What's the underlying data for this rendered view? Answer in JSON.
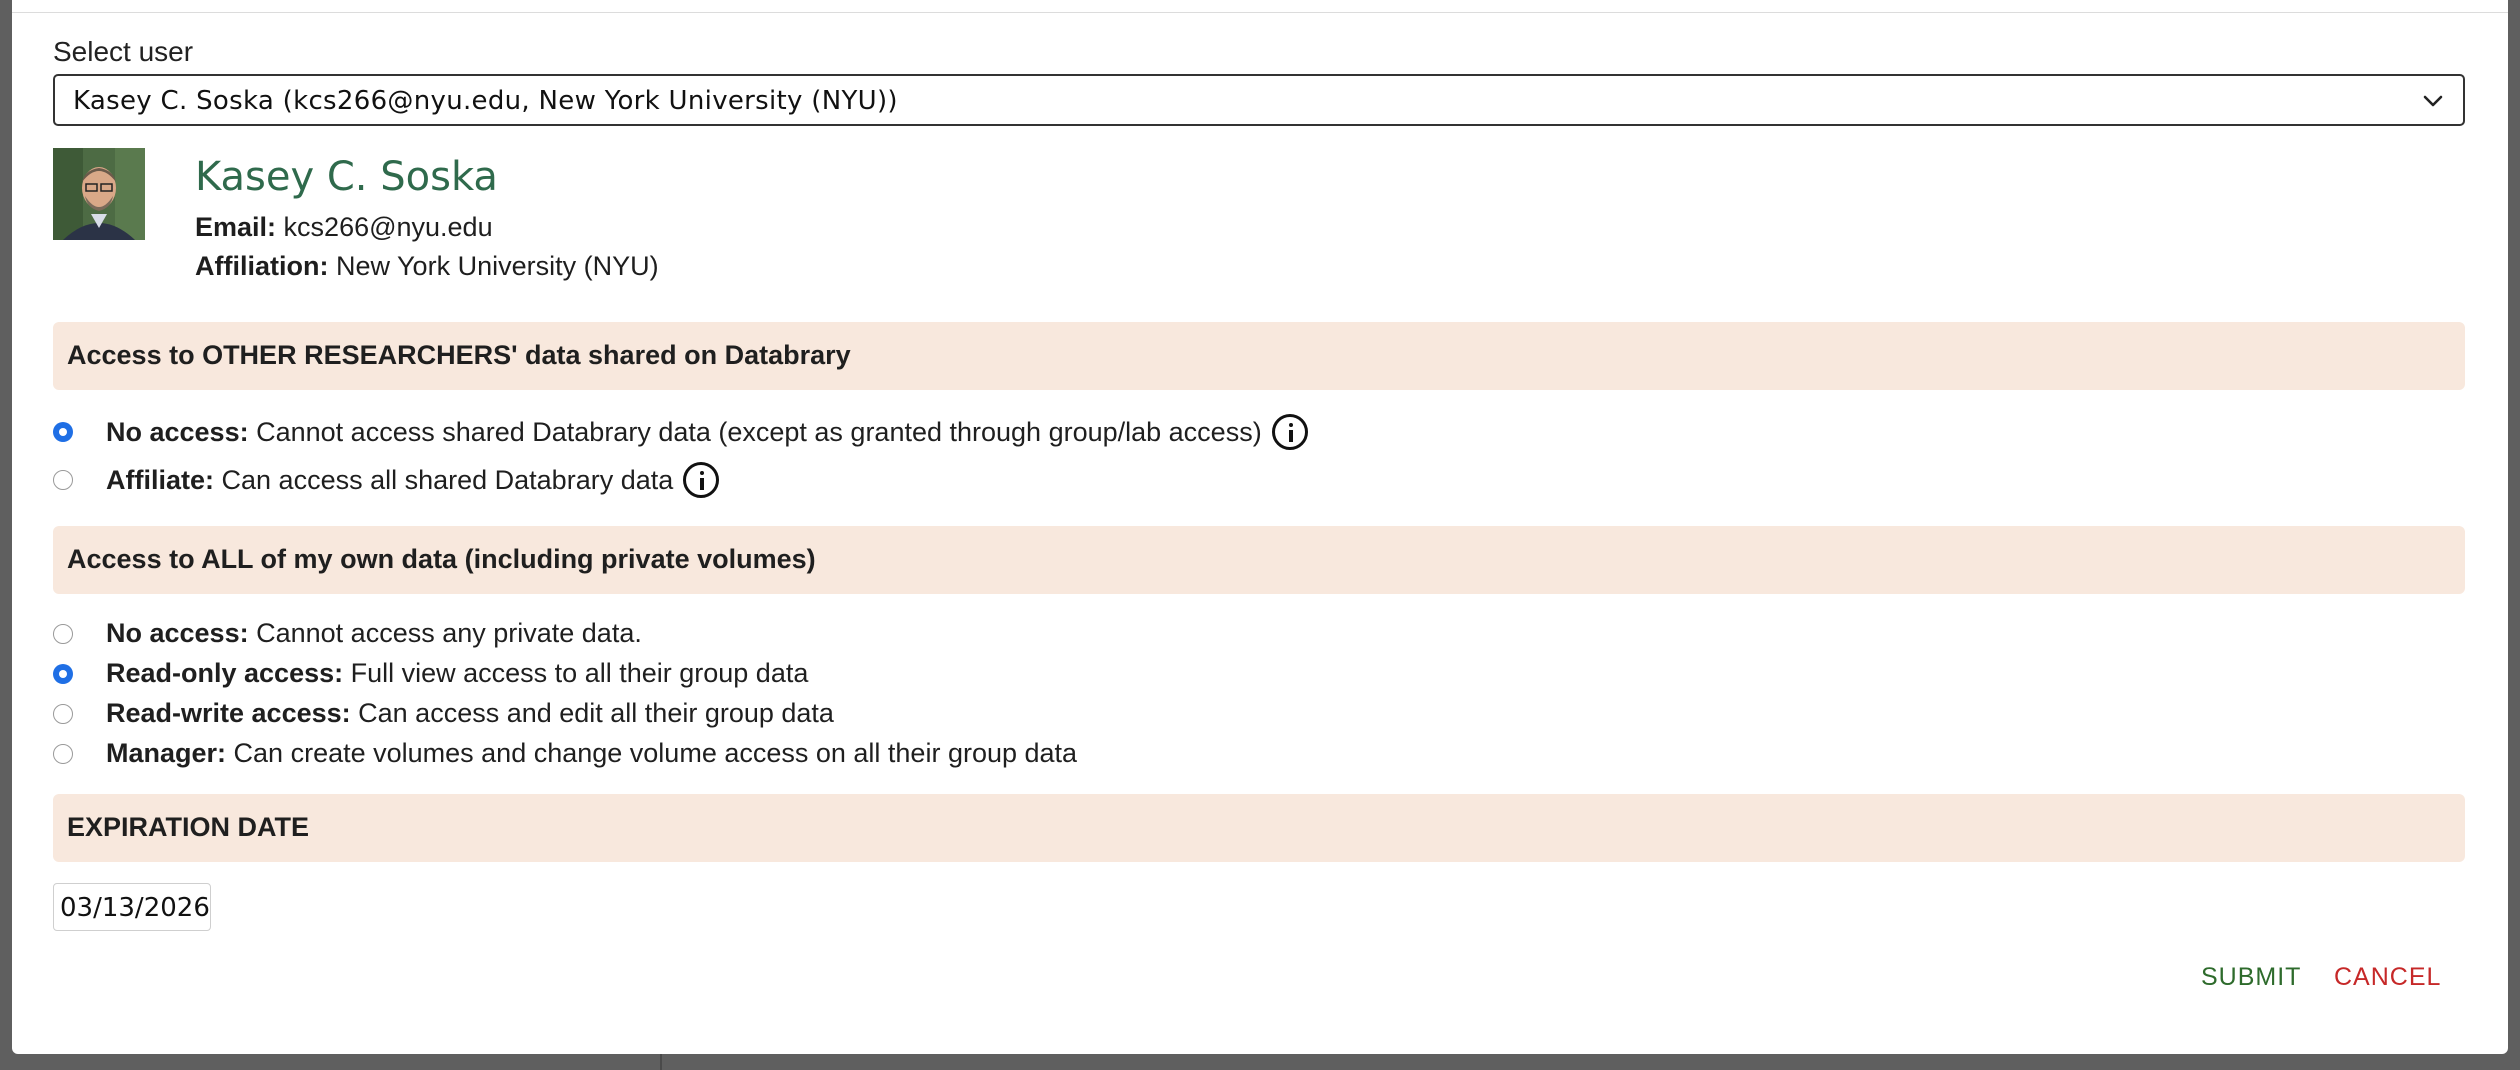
{
  "select": {
    "label": "Select user",
    "value": "Kasey C. Soska (kcs266@nyu.edu, New York University (NYU))"
  },
  "user": {
    "name": "Kasey C. Soska",
    "email_label": "Email:",
    "email": "kcs266@nyu.edu",
    "affiliation_label": "Affiliation:",
    "affiliation": "New York University (NYU)"
  },
  "sections": {
    "other_data": "Access to OTHER RESEARCHERS' data shared on Databrary",
    "own_data": "Access to ALL of my own data (including private volumes)",
    "expiration": "EXPIRATION DATE"
  },
  "other_access": [
    {
      "label": "No access:",
      "desc": "Cannot access shared Databrary data (except as granted through group/lab access)",
      "checked": true
    },
    {
      "label": "Affiliate:",
      "desc": "Can access all shared Databrary data",
      "checked": false
    }
  ],
  "own_access": [
    {
      "label": "No access:",
      "desc": "Cannot access any private data.",
      "checked": false
    },
    {
      "label": "Read-only access:",
      "desc": "Full view access to all their group data",
      "checked": true
    },
    {
      "label": "Read-write access:",
      "desc": "Can access and edit all their group data",
      "checked": false
    },
    {
      "label": "Manager:",
      "desc": "Can create volumes and change volume access on all their group data",
      "checked": false
    }
  ],
  "expiration_date": "03/13/2026",
  "buttons": {
    "submit": "SUBMIT",
    "cancel": "CANCEL"
  },
  "colors": {
    "accent_blue": "#1f6fe5",
    "name_green": "#2f6a4c",
    "section_bg": "#f8e8dd",
    "submit_green": "#2e6b2c",
    "cancel_red": "#c62828"
  }
}
